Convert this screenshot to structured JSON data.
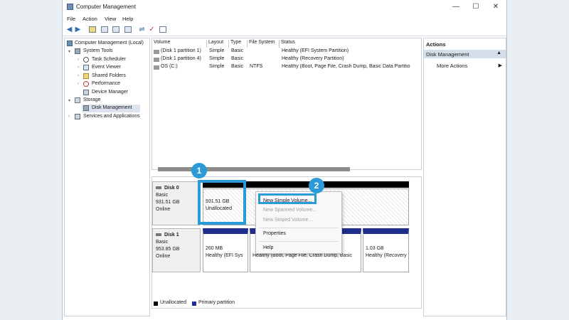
{
  "window": {
    "title": "Computer Management",
    "min": "—",
    "max": "☐",
    "close": "✕"
  },
  "menu": [
    "File",
    "Action",
    "View",
    "Help"
  ],
  "tree": {
    "root": "Computer Management (Local)",
    "system_tools": "System Tools",
    "task_scheduler": "Task Scheduler",
    "event_viewer": "Event Viewer",
    "shared_folders": "Shared Folders",
    "performance": "Performance",
    "device_manager": "Device Manager",
    "storage": "Storage",
    "disk_management": "Disk Management",
    "services": "Services and Applications"
  },
  "volumes": {
    "headers": [
      "Volume",
      "Layout",
      "Type",
      "File System",
      "Status"
    ],
    "rows": [
      {
        "volume": "(Disk 1 partition 1)",
        "layout": "Simple",
        "type": "Basic",
        "fs": "",
        "status": "Healthy (EFI System Partition)"
      },
      {
        "volume": "(Disk 1 partition 4)",
        "layout": "Simple",
        "type": "Basic",
        "fs": "",
        "status": "Healthy (Recovery Partition)"
      },
      {
        "volume": "OS (C:)",
        "layout": "Simple",
        "type": "Basic",
        "fs": "NTFS",
        "status": "Healthy (Boot, Page File, Crash Dump, Basic Data Partitio"
      }
    ]
  },
  "disks": {
    "disk0": {
      "name": "Disk 0",
      "type": "Basic",
      "size": "931.51 GB",
      "state": "Online",
      "part_size": "931.51 GB",
      "part_label": "Unallocated"
    },
    "disk1": {
      "name": "Disk 1",
      "type": "Basic",
      "size": "953.85 GB",
      "state": "Online",
      "p1_size": "260 MB",
      "p1_status": "Healthy (EFI Sys",
      "p2_status": "Healthy (Boot, Page File, Crash Dump, Basic",
      "p3_size": "1.03 GB",
      "p3_status": "Healthy (Recovery Pa"
    }
  },
  "legend": {
    "unallocated": "Unallocated",
    "primary": "Primary partition"
  },
  "actions": {
    "header": "Actions",
    "section": "Disk Management",
    "more": "More Actions"
  },
  "context_menu": {
    "new_simple": "New Simple Volume...",
    "new_spanned": "New Spanned Volume...",
    "new_striped": "New Striped Volume...",
    "properties": "Properties",
    "help": "Help"
  },
  "badges": {
    "one": "1",
    "two": "2"
  },
  "colors": {
    "accent": "#2a9ad8",
    "primary_partition": "#1f2d8f",
    "unallocated": "#000000"
  }
}
